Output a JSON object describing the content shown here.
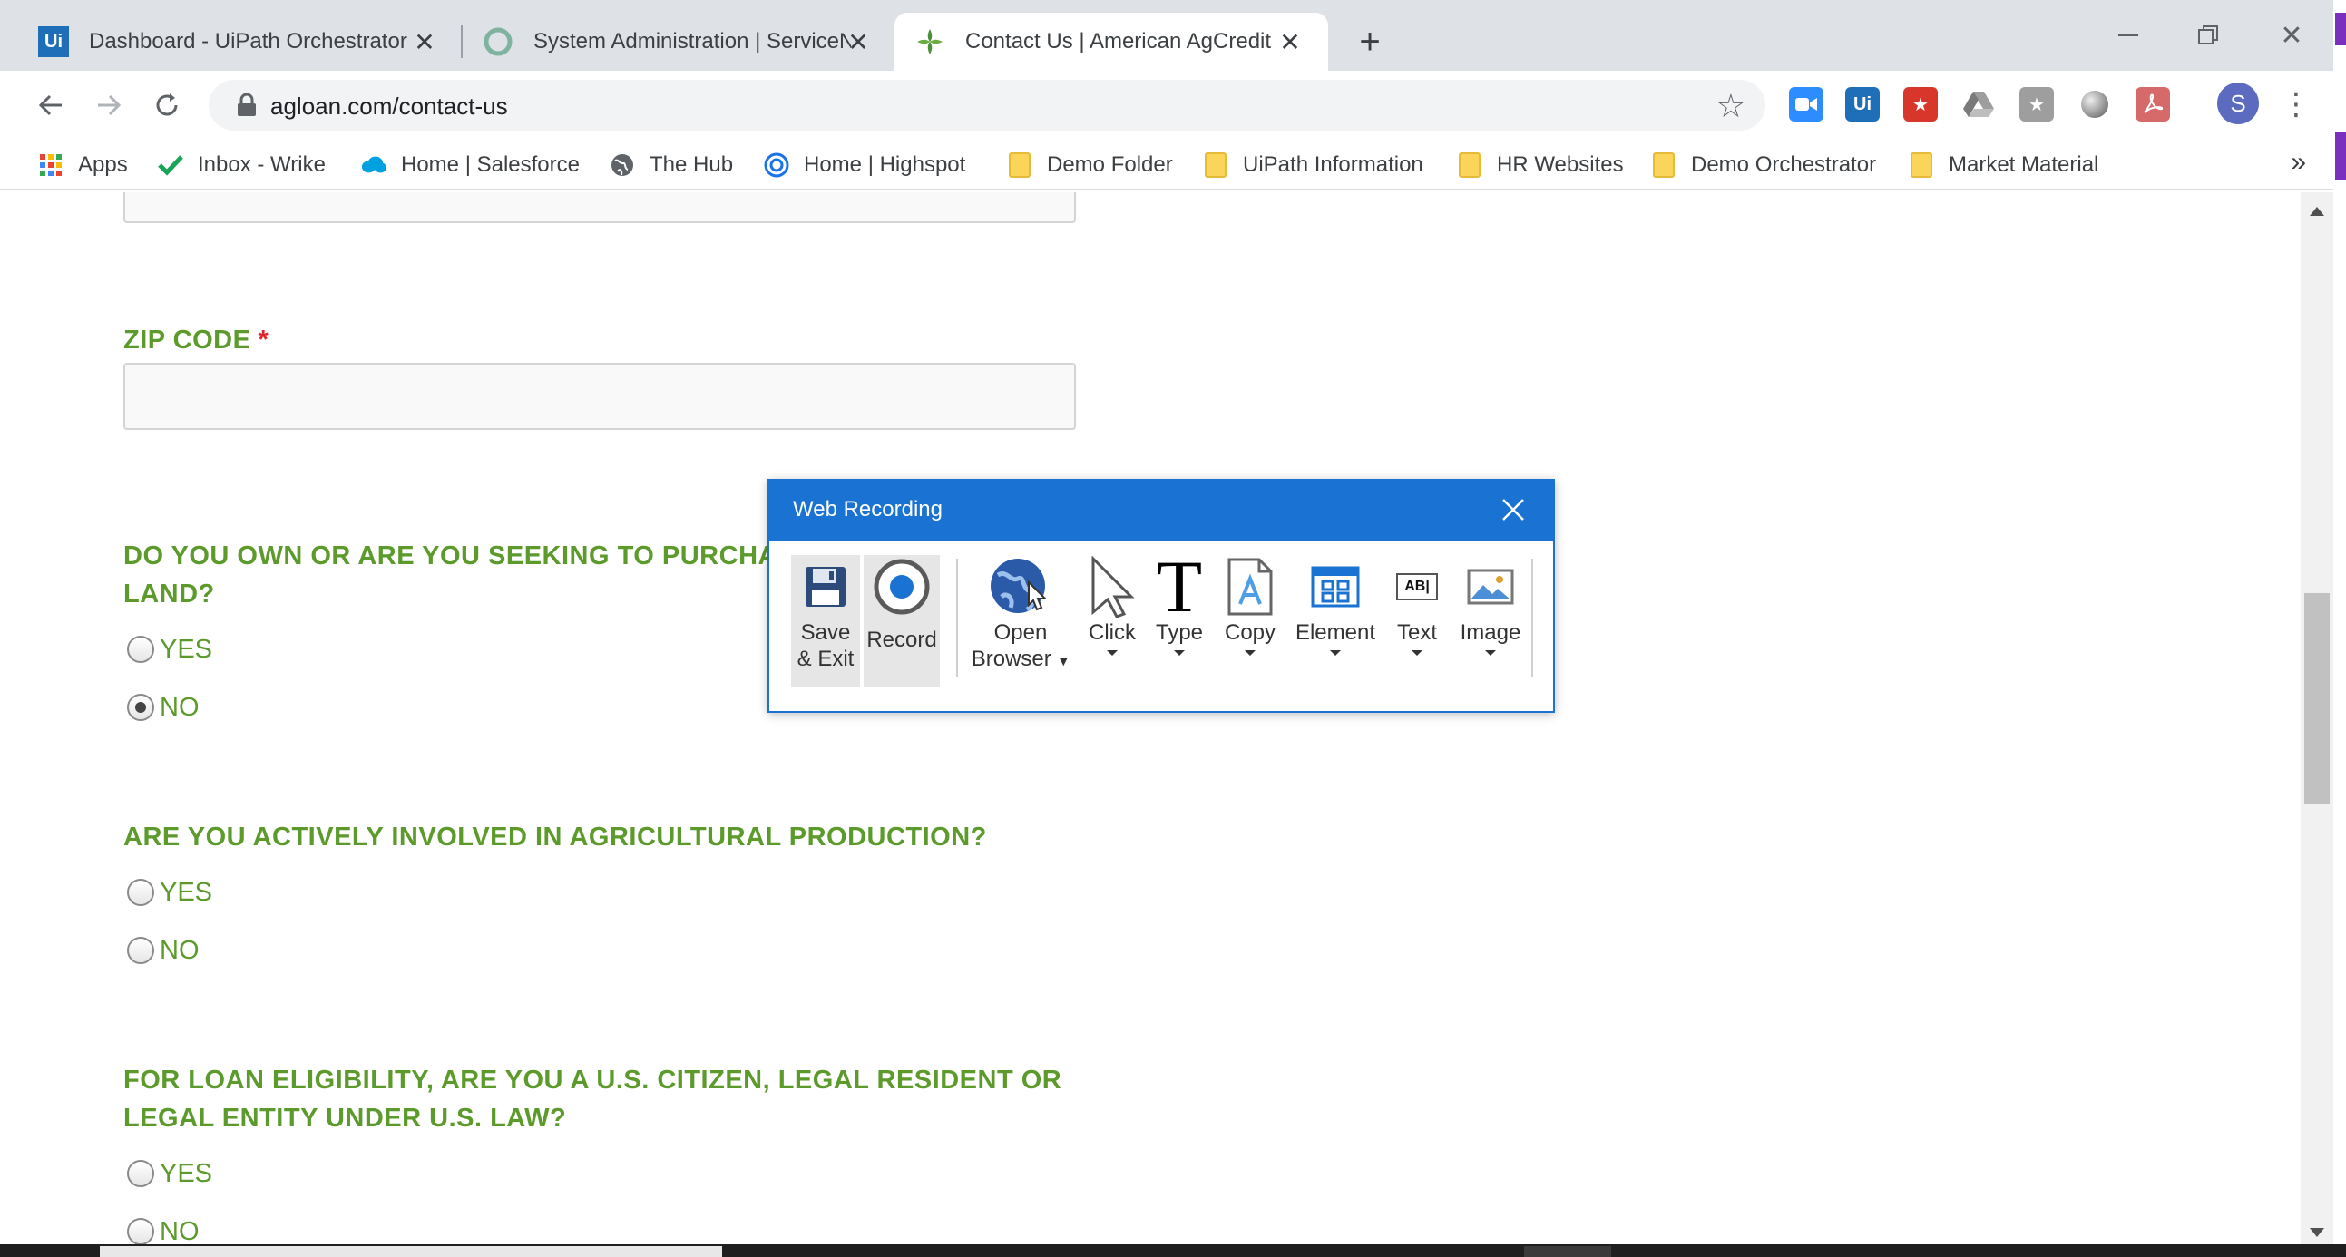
{
  "browser": {
    "tabs": [
      {
        "title": "Dashboard - UiPath Orchestrator",
        "favicon": "uipath-logo-icon",
        "active": false
      },
      {
        "title": "System Administration | ServiceN",
        "favicon": "servicenow-logo-icon",
        "active": false
      },
      {
        "title": "Contact Us | American AgCredit",
        "favicon": "agcredit-logo-icon",
        "active": true
      }
    ],
    "url": "agloan.com/contact-us",
    "profile_initial": "S",
    "bookmarks": [
      {
        "label": "Apps",
        "icon": "apps-grid-icon"
      },
      {
        "label": "Inbox - Wrike",
        "icon": "wrike-check-icon"
      },
      {
        "label": "Home | Salesforce",
        "icon": "salesforce-cloud-icon"
      },
      {
        "label": "The Hub",
        "icon": "globe-icon"
      },
      {
        "label": "Home | Highspot",
        "icon": "highspot-icon"
      },
      {
        "label": "Demo Folder",
        "icon": "folder-icon"
      },
      {
        "label": "UiPath Information",
        "icon": "folder-icon"
      },
      {
        "label": "HR Websites",
        "icon": "folder-icon"
      },
      {
        "label": "Demo Orchestrator",
        "icon": "folder-icon"
      },
      {
        "label": "Market Material",
        "icon": "folder-icon"
      }
    ],
    "bookmarks_more": "»",
    "extension_ui_label": "Ui",
    "tab_favicon_ui_label": "Ui"
  },
  "form": {
    "zip_label": "ZIP CODE",
    "required_mark": "*",
    "q1_line1": "DO YOU OWN OR ARE YOU SEEKING TO PURCHASE",
    "q1_line2": "LAND?",
    "q2": "ARE YOU ACTIVELY INVOLVED IN AGRICULTURAL PRODUCTION?",
    "q3_line1": "FOR LOAN ELIGIBILITY, ARE YOU A U.S. CITIZEN, LEGAL RESIDENT OR",
    "q3_line2": "LEGAL ENTITY UNDER U.S. LAW?",
    "yes": "YES",
    "no": "NO",
    "q1_selected": "NO"
  },
  "recorder": {
    "title": "Web Recording",
    "tools": {
      "save_line1": "Save",
      "save_line2": "& Exit",
      "record": "Record",
      "open_line1": "Open",
      "open_line2": "Browser",
      "click": "Click",
      "type": "Type",
      "type_glyph": "T",
      "copy": "Copy",
      "element": "Element",
      "text": "Text",
      "text_glyph": "AB",
      "image": "Image"
    }
  },
  "colors": {
    "accent_green": "#5c9a2b",
    "required_red": "#e0262d",
    "dialog_blue": "#1a73d2"
  }
}
